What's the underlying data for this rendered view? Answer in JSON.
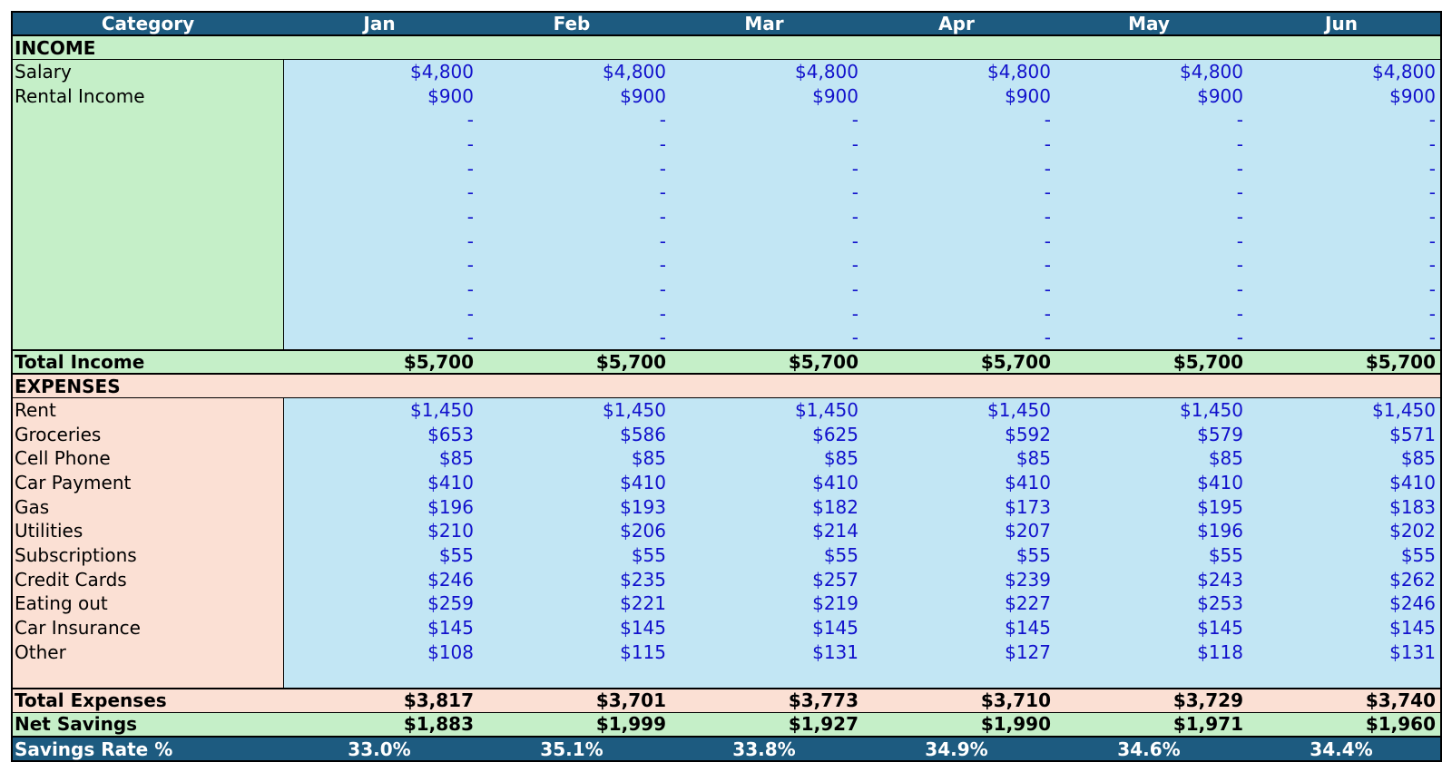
{
  "months": [
    "Jan",
    "Feb",
    "Mar",
    "Apr",
    "May",
    "Jun"
  ],
  "header": {
    "category": "Category"
  },
  "income": {
    "section_label": "INCOME",
    "rows": [
      {
        "label": "Salary",
        "values": [
          "$4,800",
          "$4,800",
          "$4,800",
          "$4,800",
          "$4,800",
          "$4,800"
        ]
      },
      {
        "label": "Rental Income",
        "values": [
          "$900",
          "$900",
          "$900",
          "$900",
          "$900",
          "$900"
        ]
      }
    ],
    "empty_rows": 10,
    "empty_value": "-",
    "total_label": "Total Income",
    "totals": [
      "$5,700",
      "$5,700",
      "$5,700",
      "$5,700",
      "$5,700",
      "$5,700"
    ]
  },
  "expenses": {
    "section_label": "EXPENSES",
    "rows": [
      {
        "label": "Rent",
        "values": [
          "$1,450",
          "$1,450",
          "$1,450",
          "$1,450",
          "$1,450",
          "$1,450"
        ]
      },
      {
        "label": "Groceries",
        "values": [
          "$653",
          "$586",
          "$625",
          "$592",
          "$579",
          "$571"
        ]
      },
      {
        "label": "Cell Phone",
        "values": [
          "$85",
          "$85",
          "$85",
          "$85",
          "$85",
          "$85"
        ]
      },
      {
        "label": "Car Payment",
        "values": [
          "$410",
          "$410",
          "$410",
          "$410",
          "$410",
          "$410"
        ]
      },
      {
        "label": "Gas",
        "values": [
          "$196",
          "$193",
          "$182",
          "$173",
          "$195",
          "$183"
        ]
      },
      {
        "label": "Utilities",
        "values": [
          "$210",
          "$206",
          "$214",
          "$207",
          "$196",
          "$202"
        ]
      },
      {
        "label": "Subscriptions",
        "values": [
          "$55",
          "$55",
          "$55",
          "$55",
          "$55",
          "$55"
        ]
      },
      {
        "label": "Credit Cards",
        "values": [
          "$246",
          "$235",
          "$257",
          "$239",
          "$243",
          "$262"
        ]
      },
      {
        "label": "Eating out",
        "values": [
          "$259",
          "$221",
          "$219",
          "$227",
          "$253",
          "$246"
        ]
      },
      {
        "label": "Car Insurance",
        "values": [
          "$145",
          "$145",
          "$145",
          "$145",
          "$145",
          "$145"
        ]
      },
      {
        "label": "Other",
        "values": [
          "$108",
          "$115",
          "$131",
          "$127",
          "$118",
          "$131"
        ]
      }
    ],
    "empty_rows": 1,
    "total_label": "Total Expenses",
    "totals": [
      "$3,817",
      "$3,701",
      "$3,773",
      "$3,710",
      "$3,729",
      "$3,740"
    ]
  },
  "net_savings": {
    "label": "Net Savings",
    "values": [
      "$1,883",
      "$1,999",
      "$1,927",
      "$1,990",
      "$1,971",
      "$1,960"
    ]
  },
  "savings_rate": {
    "label": "Savings Rate %",
    "values": [
      "33.0%",
      "35.1%",
      "33.8%",
      "34.9%",
      "34.6%",
      "34.4%"
    ]
  },
  "colors": {
    "header_bg": "#1d5b80",
    "income_green": "#c5efc8",
    "expense_peach": "#fbe0d4",
    "input_blue": "#c2e6f4",
    "input_text": "#1111cc"
  }
}
